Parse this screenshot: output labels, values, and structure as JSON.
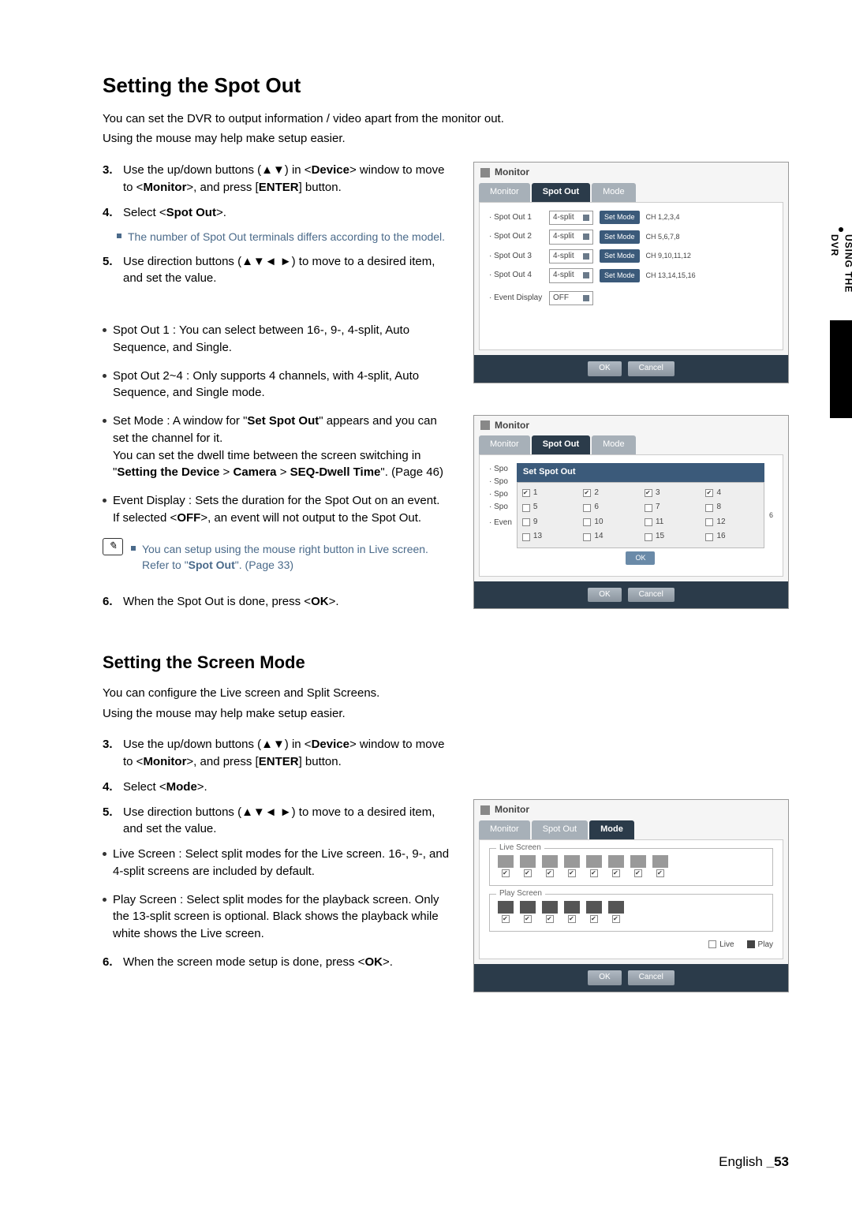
{
  "sideTab": "USING THE DVR",
  "spotOut": {
    "heading": "Setting the Spot Out",
    "lead": "You can set the DVR to output information / video apart from the monitor out.",
    "sub": "Using the mouse may help make setup easier.",
    "step3Num": "3.",
    "step3": "Use the up/down buttons (▲▼) in <Device> window to move to <Monitor>, and press [ENTER] button.",
    "step4Num": "4.",
    "step4": "Select <Spot Out>.",
    "sub4": "The number of Spot Out terminals differs according to the model.",
    "step5Num": "5.",
    "step5": "Use direction buttons (▲▼◄ ►) to move to a desired item, and set the value.",
    "b1": "Spot Out 1 : You can select between 16-, 9-, 4-split, Auto Sequence, and Single.",
    "b2": "Spot Out 2~4 : Only supports 4 channels, with 4-split, Auto Sequence, and Single mode.",
    "b3a": "Set Mode : A window for \"Set Spot Out\" appears and you can set the channel for it.",
    "b3b": "You can set the dwell time between the screen switching in \"Setting the Device > Camera > SEQ-Dwell Time\". (Page 46)",
    "b4a": "Event Display : Sets the duration for the Spot Out on an event.",
    "b4b": "If selected <OFF>, an event will not output to the Spot Out.",
    "note1": "You can setup using the mouse right button in Live screen.",
    "note2": "Refer to \"Spot Out\". (Page 33)",
    "step6Num": "6.",
    "step6": "When the Spot Out is done, press <OK>."
  },
  "screenMode": {
    "heading": "Setting the Screen Mode",
    "lead": "You can configure the Live screen and Split Screens.",
    "sub": "Using the mouse may help make setup easier.",
    "step3Num": "3.",
    "step3": "Use the up/down buttons (▲▼) in <Device> window to move to <Monitor>, and press [ENTER] button.",
    "step4Num": "4.",
    "step4": "Select <Mode>.",
    "step5Num": "5.",
    "step5": "Use direction buttons (▲▼◄ ►) to move to a desired item, and set the value.",
    "b1": "Live Screen : Select split modes for the Live screen. 16-, 9-, and 4-split screens are included by default.",
    "b2": "Play Screen : Select split modes for the playback screen. Only the 13-split screen is optional. Black shows the playback while white shows the Live screen.",
    "step6Num": "6.",
    "step6": "When the screen mode setup is done, press <OK>."
  },
  "dlg": {
    "title": "Monitor",
    "tabs": [
      "Monitor",
      "Spot Out",
      "Mode"
    ],
    "rows": [
      {
        "lbl": "· Spot Out 1",
        "mode": "4-split",
        "ch": "CH 1,2,3,4"
      },
      {
        "lbl": "· Spot Out 2",
        "mode": "4-split",
        "ch": "CH 5,6,7,8"
      },
      {
        "lbl": "· Spot Out 3",
        "mode": "4-split",
        "ch": "CH 9,10,11,12"
      },
      {
        "lbl": "· Spot Out 4",
        "mode": "4-split",
        "ch": "CH 13,14,15,16"
      }
    ],
    "evtLbl": "· Event Display",
    "evtVal": "OFF",
    "setMode": "Set Mode",
    "ok": "OK",
    "cancel": "Cancel",
    "setSpotOut": "Set Spot Out",
    "cells": [
      {
        "n": "1",
        "on": true
      },
      {
        "n": "2",
        "on": true
      },
      {
        "n": "3",
        "on": true
      },
      {
        "n": "4",
        "on": true
      },
      {
        "n": "5",
        "on": false
      },
      {
        "n": "6",
        "on": false
      },
      {
        "n": "7",
        "on": false
      },
      {
        "n": "8",
        "on": false
      },
      {
        "n": "9",
        "on": false
      },
      {
        "n": "10",
        "on": false
      },
      {
        "n": "11",
        "on": false
      },
      {
        "n": "12",
        "on": false
      },
      {
        "n": "13",
        "on": false
      },
      {
        "n": "14",
        "on": false
      },
      {
        "n": "15",
        "on": false
      },
      {
        "n": "16",
        "on": false
      }
    ],
    "d2Shorts": [
      "· Spo",
      "· Spo",
      "· Spo",
      "· Spo"
    ],
    "d2Event": "· Even",
    "liveScreen": "Live Screen",
    "playScreen": "Play Screen",
    "live": "Live",
    "play": "Play"
  },
  "footer": {
    "lang": "English",
    "page": "_53"
  }
}
